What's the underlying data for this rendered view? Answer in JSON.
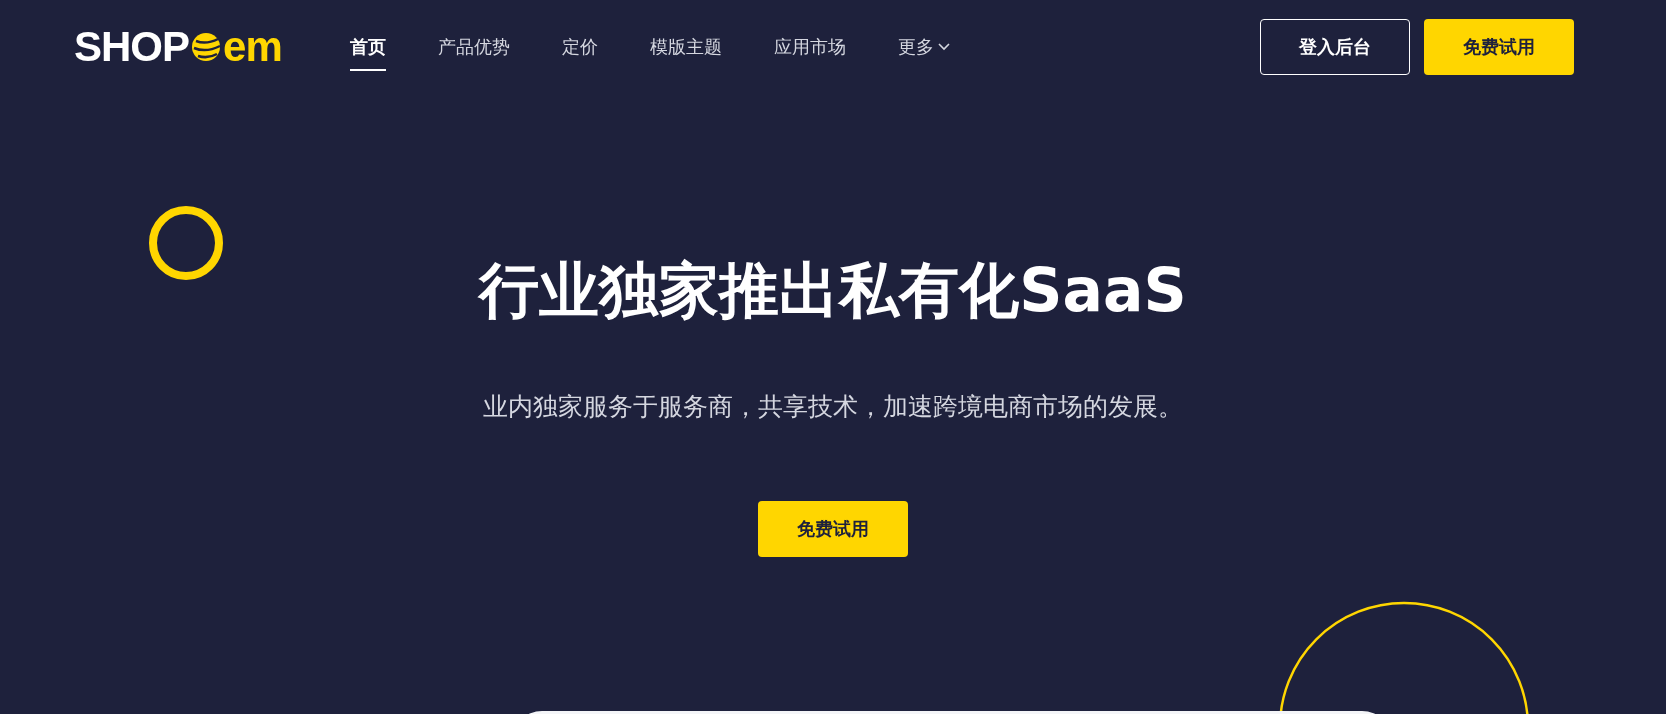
{
  "header": {
    "logo": {
      "left": "SHOP",
      "right": "em"
    },
    "nav": [
      {
        "label": "首页",
        "selected": true,
        "has_menu": false
      },
      {
        "label": "产品优势",
        "selected": false,
        "has_menu": false
      },
      {
        "label": "定价",
        "selected": false,
        "has_menu": false
      },
      {
        "label": "模版主题",
        "selected": false,
        "has_menu": false
      },
      {
        "label": "应用市场",
        "selected": false,
        "has_menu": false
      },
      {
        "label": "更多",
        "selected": false,
        "has_menu": true
      }
    ],
    "buttons": [
      {
        "label": "登入后台",
        "kind": "outline"
      },
      {
        "label": "免费试用",
        "kind": "primary"
      }
    ]
  },
  "hero": {
    "title": "行业独家推出私有化SaaS",
    "subtitle": "业内独家服务于服务商，共享技术，加速跨境电商市场的发展。",
    "cta": "免费试用"
  }
}
